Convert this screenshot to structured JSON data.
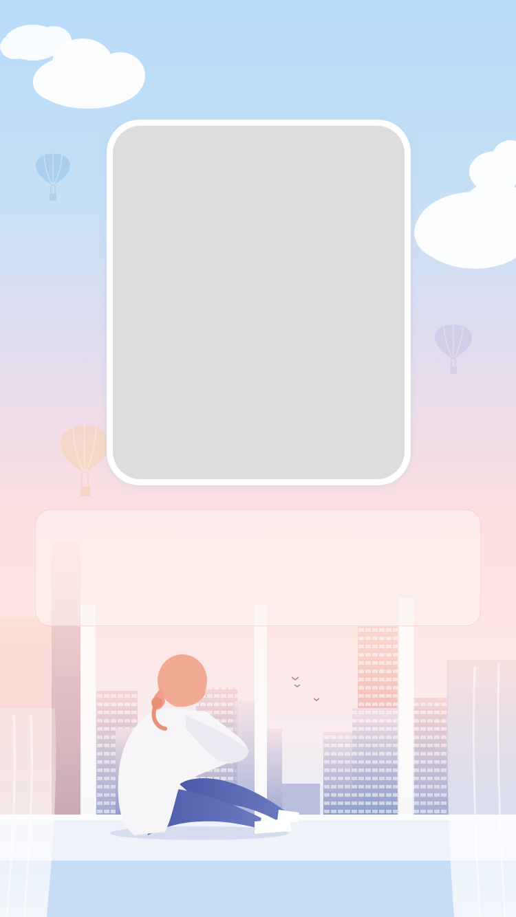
{
  "photo_card": {
    "state": "empty"
  },
  "text_panel": {
    "content": ""
  },
  "decor": {
    "sky_top": "#b8dcfa",
    "sky_mid": "#fbe0e2",
    "photo_placeholder": "#dcdcdc",
    "frame": "#ffffff",
    "building_blue": "#8e9ccb",
    "building_pink": "#f2b0a8",
    "hair": "#f1a68f"
  }
}
